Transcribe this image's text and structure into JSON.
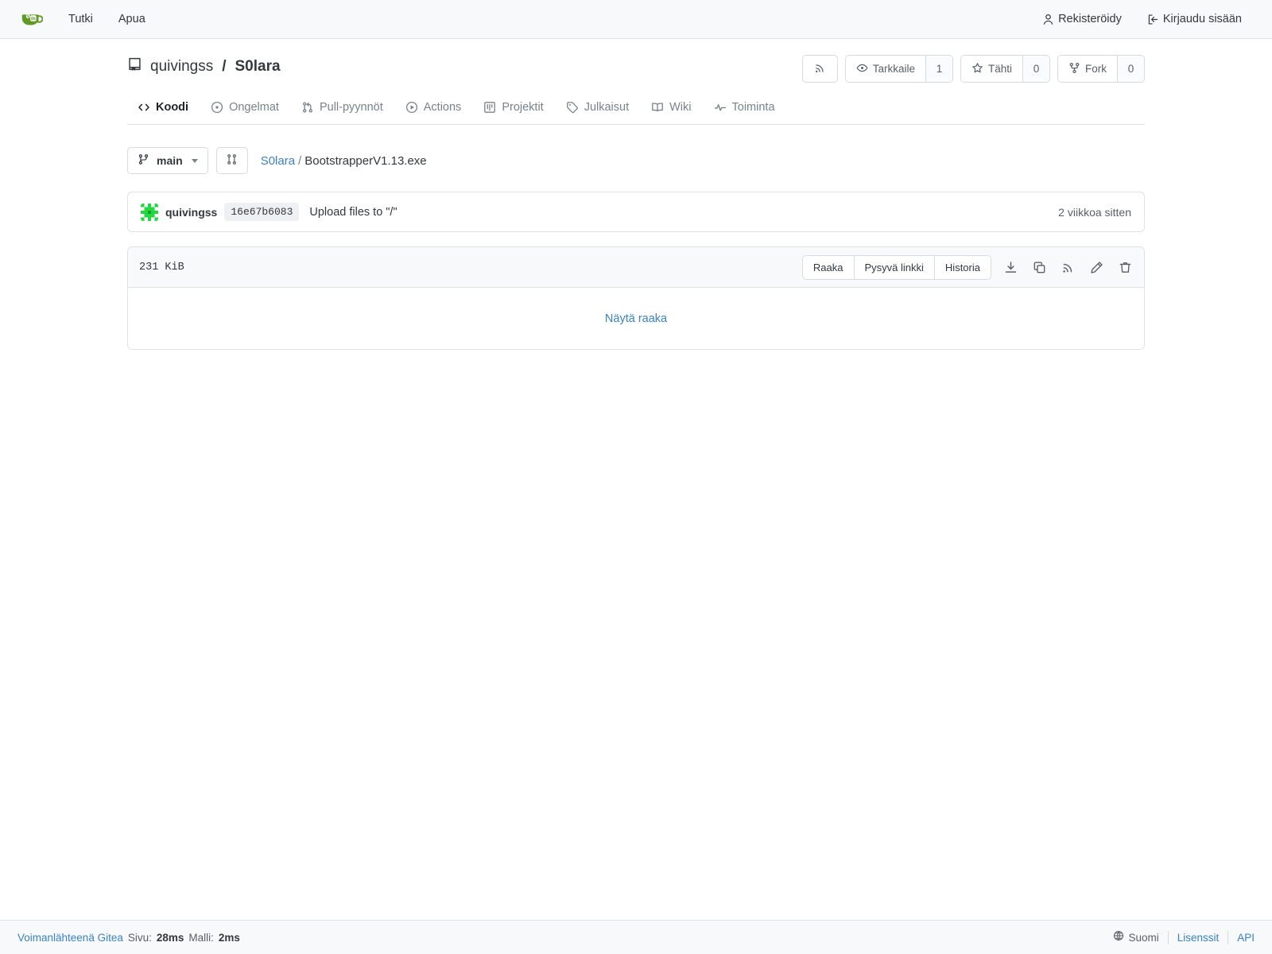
{
  "navbar": {
    "logo_icon": "gitea-mug-logo",
    "items": [
      {
        "label": "Tutki",
        "icon": "none"
      },
      {
        "label": "Apua",
        "icon": "none"
      }
    ],
    "right_items": [
      {
        "label": "Rekisteröidy",
        "icon": "person-icon"
      },
      {
        "label": "Kirjaudu sisään",
        "icon": "sign-in-icon"
      }
    ]
  },
  "repo": {
    "icon": "repo-icon",
    "owner": "quivingss",
    "separator": "/",
    "name": "S0lara",
    "actions": {
      "rss_icon": "rss-icon",
      "watch_label": "Tarkkaile",
      "watch_icon": "eye-icon",
      "watch_count": "1",
      "star_label": "Tähti",
      "star_icon": "star-icon",
      "star_count": "0",
      "fork_label": "Fork",
      "fork_icon": "fork-icon",
      "fork_count": "0"
    },
    "tabs": [
      {
        "label": "Koodi",
        "icon": "code-icon",
        "active": true
      },
      {
        "label": "Ongelmat",
        "icon": "issue-opened-icon",
        "active": false
      },
      {
        "label": "Pull-pyynnöt",
        "icon": "git-pull-request-icon",
        "active": false
      },
      {
        "label": "Actions",
        "icon": "play-icon",
        "active": false
      },
      {
        "label": "Projektit",
        "icon": "project-icon",
        "active": false
      },
      {
        "label": "Julkaisut",
        "icon": "tag-icon",
        "active": false
      },
      {
        "label": "Wiki",
        "icon": "book-icon",
        "active": false
      },
      {
        "label": "Toiminta",
        "icon": "pulse-icon",
        "active": false
      }
    ]
  },
  "path_row": {
    "branch_icon": "git-branch-icon",
    "branch_name": "main",
    "compare_icon": "git-compare-icon",
    "breadcrumb_root": "S0lara",
    "breadcrumb_sep": "/",
    "breadcrumb_file": "BootstrapperV1.13.exe"
  },
  "commit": {
    "avatar": "identicon-green",
    "author": "quivingss",
    "sha": "16e67b6083",
    "message": "Upload files to \"/\"",
    "time": "2 viikkoa sitten"
  },
  "file": {
    "size": "231 KiB",
    "buttons": [
      {
        "label": "Raaka"
      },
      {
        "label": "Pysyvä linkki"
      },
      {
        "label": "Historia"
      }
    ],
    "icon_buttons": [
      {
        "name": "download-icon"
      },
      {
        "name": "copy-icon"
      },
      {
        "name": "rss-icon"
      },
      {
        "name": "pencil-icon"
      },
      {
        "name": "trash-icon"
      }
    ],
    "raw_link": "Näytä raaka"
  },
  "footer": {
    "powered_by": "Voimanlähteenä Gitea",
    "page_label": "Sivu:",
    "page_time": "28ms",
    "template_label": "Malli:",
    "template_time": "2ms",
    "language": "Suomi",
    "language_icon": "globe-icon",
    "licenses": "Lisenssit",
    "api": "API"
  },
  "colors": {
    "link": "#3b82c4",
    "brand_green": "#609926",
    "text": "#33383d",
    "muted": "#7a8288",
    "border": "#e0e3e6",
    "surface": "#f8f9fb"
  }
}
